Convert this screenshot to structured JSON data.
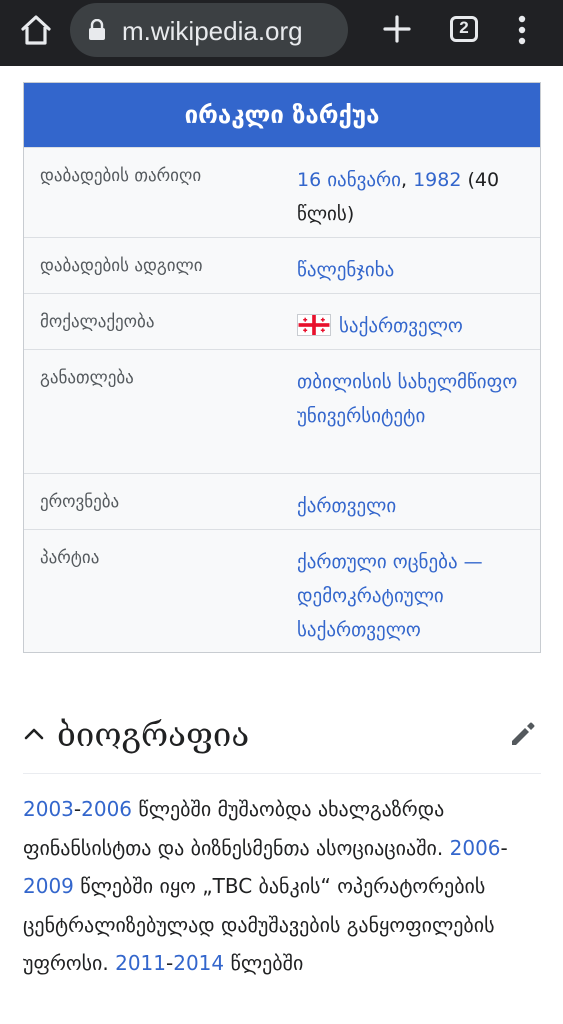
{
  "browser": {
    "url": "m.wikipedia.org",
    "tab_count": "2",
    "icons": [
      "home-icon",
      "lock-icon",
      "plus-icon",
      "tabs-icon",
      "more-vert-icon"
    ]
  },
  "infobox": {
    "title": "ირაკლი ზარქუა",
    "rows": [
      {
        "label": "დაბადების თარიღი",
        "value": [
          "16 იანვარი",
          ", ",
          "1982",
          " (40 წლის)"
        ]
      },
      {
        "label": "დაბადების ადგილი",
        "value": "წალენჯიხა"
      },
      {
        "label": "მოქალაქეობა",
        "value": "საქართველო"
      },
      {
        "label": "განათლება",
        "value": "თბილისის სახელმწიფო უნივერსიტეტი"
      },
      {
        "label": "ეროვნება",
        "value": "ქართველი"
      },
      {
        "label": "პარტია",
        "value": "ქართული ოცნება — დემოკრატიული საქართველო"
      }
    ]
  },
  "section": {
    "title": "ბიოგრაფია",
    "paragraph": [
      "2003",
      "-",
      "2006",
      " წლებში მუშაობდა ახალგაზრდა ფინანსისტთა და ბიზნესმენთა ასოციაციაში. ",
      "2006",
      "-",
      "2009",
      " წლებში იყო „TBC ბანკის“ ოპერატორების ცენტრალიზებულად დამუშავების განყოფილების უფროსი. ",
      "2011",
      "-",
      "2014",
      " წლებში"
    ]
  },
  "colors": {
    "link": "#3366cc",
    "infobox_header": "#3366cc",
    "toolbar": "#202124"
  }
}
